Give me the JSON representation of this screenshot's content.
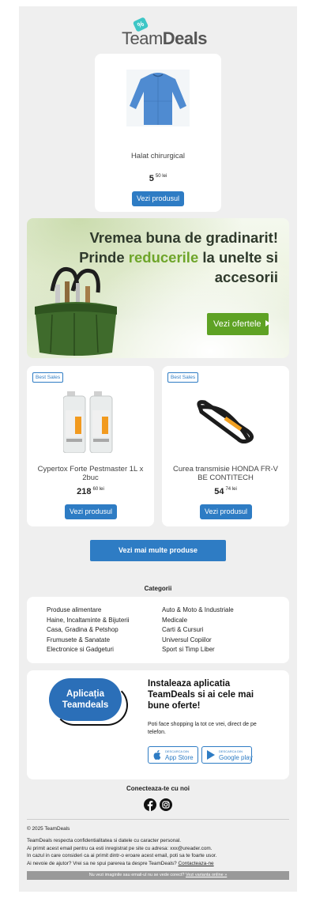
{
  "logo": {
    "team": "Team",
    "deals": "Deals",
    "tag_symbol": "%"
  },
  "featured": {
    "name": "Halat chirurgical",
    "price_main": "5",
    "price_sup": "50 lei",
    "button": "Vezi produsul"
  },
  "banner": {
    "line1": "Vremea buna de gradinarit!",
    "line2_a": "Prinde ",
    "line2_hl": "reducerile",
    "line2_b": " la unelte si",
    "line3": "accesorii",
    "cta": "Vezi ofertele"
  },
  "products": [
    {
      "badge": "Best Sales",
      "name": "Cypertox Forte Pestmaster 1L x 2buc",
      "price_main": "218",
      "price_sup": "60 lei",
      "button": "Vezi produsul"
    },
    {
      "badge": "Best Sales",
      "name": "Curea transmisie HONDA FR-V BE CONTITECH",
      "price_main": "54",
      "price_sup": "74 lei",
      "button": "Vezi produsul"
    }
  ],
  "more_button": "Vezi mai multe produse",
  "categories": {
    "title": "Categorii",
    "left": [
      "Produse alimentare",
      "Haine, Incaltaminte & Bijuterii",
      "Casa, Gradina & Petshop",
      "Frumusete & Sanatate",
      "Electronice si Gadgeturi"
    ],
    "right": [
      "Auto & Moto & Industriale",
      "Medicale",
      "Carti & Cursuri",
      "Universul Copiilor",
      "Sport si Timp Liber"
    ]
  },
  "app": {
    "pill_line1": "Aplicația",
    "pill_line2": "Teamdeals",
    "title": "Instaleaza aplicatia TeamDeals si ai cele mai bune oferte!",
    "desc": "Poti face shopping la tot ce vrei, direct de pe telefon.",
    "appstore_small": "DESCARCA DIN",
    "appstore_big": "App Store",
    "google_small": "DESCARCA DIN",
    "google_big": "Google play"
  },
  "social": {
    "title": "Conecteaza-te cu noi",
    "icons": [
      "facebook-icon",
      "instagram-icon"
    ]
  },
  "footer": {
    "copyright": "© 2025 TeamDeals",
    "line1": "TeamDeals respecta confidentialitatea si datele cu caracter personal.",
    "line2": "Ai primit acest email pentru ca esti inregistrat pe site cu adresa: xxx@ureader.com.",
    "line3": "In cazul in care consideri ca ai primit dintr-o eroare acest email, poti sa te foarte usor.",
    "line4_a": "Ai nevoie de ajutor? Vrei sa ne spui parerea ta despre TeamDeals? ",
    "line4_link": "Contacteaza-ne",
    "bar_text": "Nu vezi imaginile sau email-ul nu se vede corect? ",
    "bar_link": "Vezi varianta online »"
  },
  "colors": {
    "accent": "#2e7cc4",
    "green": "#5ea224",
    "background": "#efefef"
  }
}
